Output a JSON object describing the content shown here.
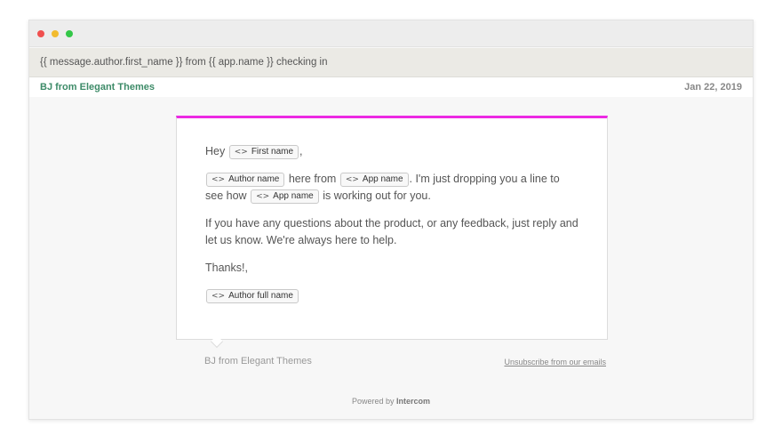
{
  "subject": "{{ message.author.first_name }} from {{ app.name }} checking in",
  "sender": "BJ from Elegant Themes",
  "date": "Jan 22, 2019",
  "body": {
    "greeting": "Hey",
    "first_name_chip": "First name",
    "author_name_chip": "Author name",
    "here_from": "here from",
    "app_name_chip": "App name",
    "line1_rest": ". I'm just dropping you a line to see",
    "how": "how",
    "working_out": "is working out for you.",
    "para2": "If you have any questions about the product, or any feedback, just reply and let us know. We're always here to help.",
    "thanks": "Thanks!,",
    "author_full_name_chip": "Author full name"
  },
  "footer": {
    "name": "BJ from Elegant Themes",
    "unsubscribe": "Unsubscribe from our emails",
    "powered_prefix": "Powered by",
    "powered_brand": "Intercom"
  },
  "colors": {
    "accent": "#ec29e3",
    "sender": "#3d8b68",
    "dot_red": "#f0504f",
    "dot_yellow": "#f2bb2f",
    "dot_green": "#33c748"
  },
  "icons": {
    "variable_chip_icon": "code-arrows-icon"
  }
}
